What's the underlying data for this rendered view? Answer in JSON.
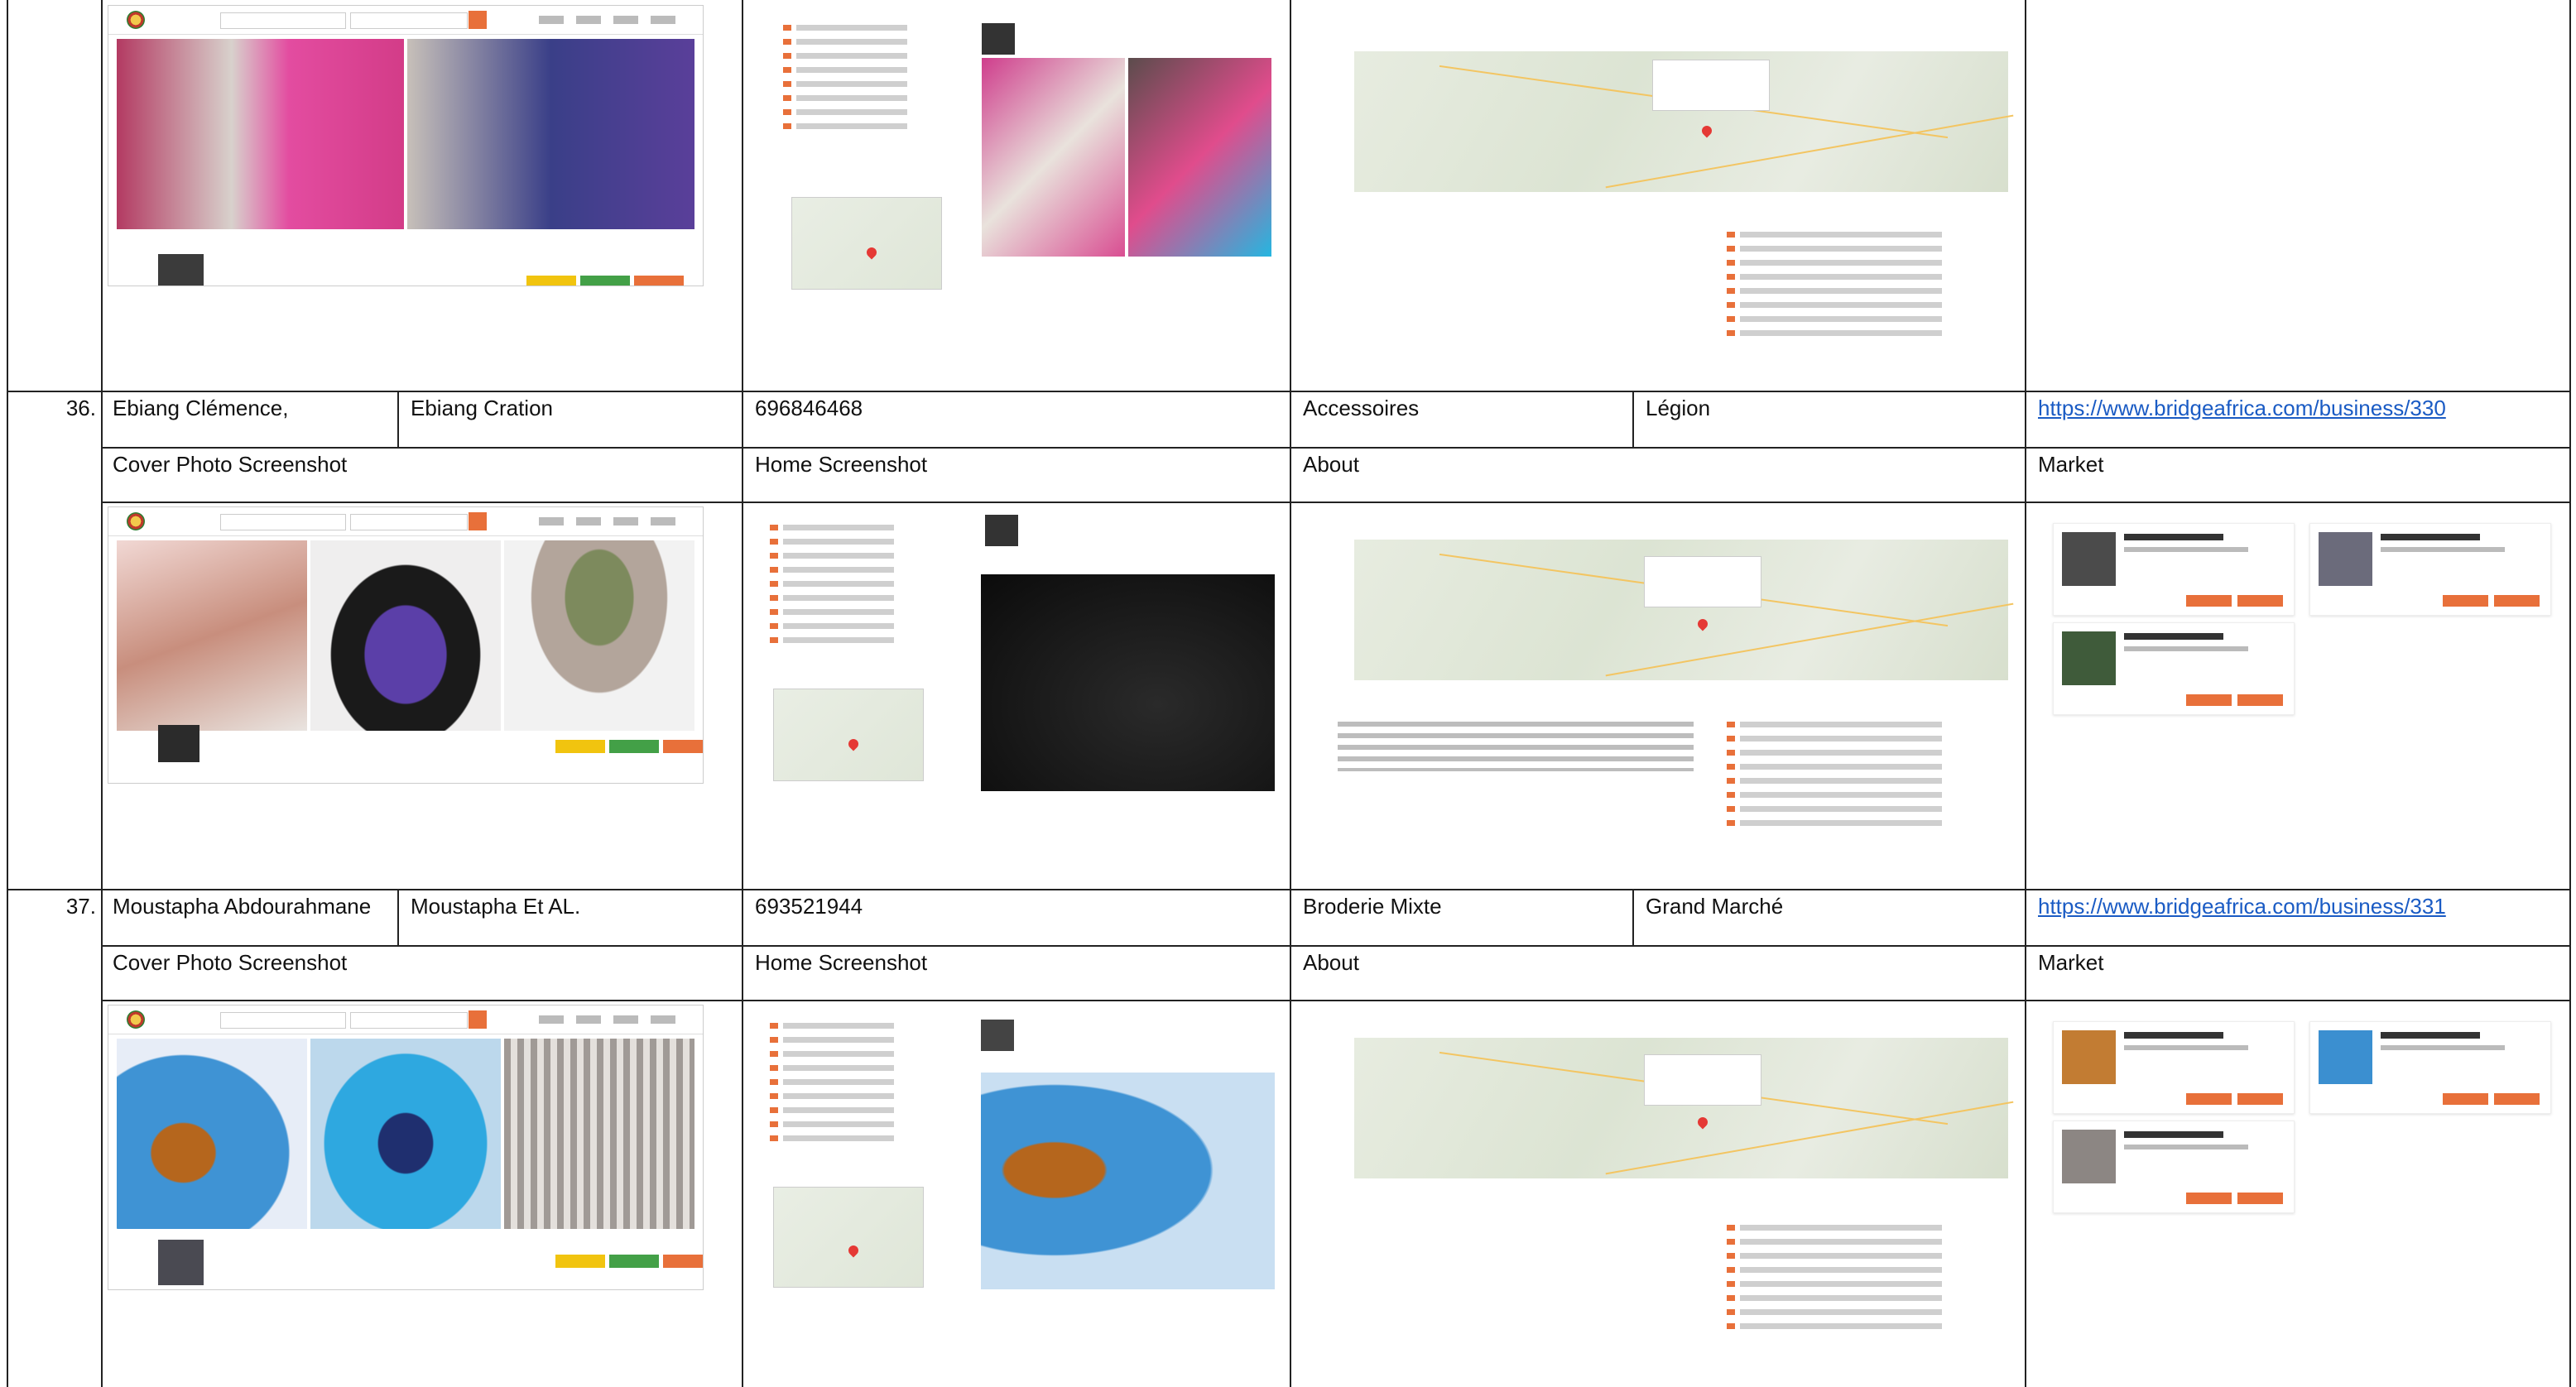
{
  "rows": [
    {
      "number": "36.",
      "owner": "Ebiang Clémence,",
      "business": "Ebiang Cration",
      "phone": "696846468",
      "category": "Accessoires",
      "location": "Légion",
      "url": "https://www.bridgeafrica.com/business/330"
    },
    {
      "number": "37.",
      "owner": "Moustapha Abdourahmane",
      "business": "Moustapha Et AL.",
      "phone": "693521944",
      "category": "Broderie Mixte",
      "location": "Grand Marché",
      "url": "https://www.bridgeafrica.com/business/331"
    }
  ],
  "section_labels": {
    "cover": "Cover Photo Screenshot",
    "home": "Home Screenshot",
    "about": "About",
    "market": "Market"
  },
  "colors": {
    "accent": "#e8703a",
    "link": "#1a5bc4",
    "grid": "#222222"
  }
}
